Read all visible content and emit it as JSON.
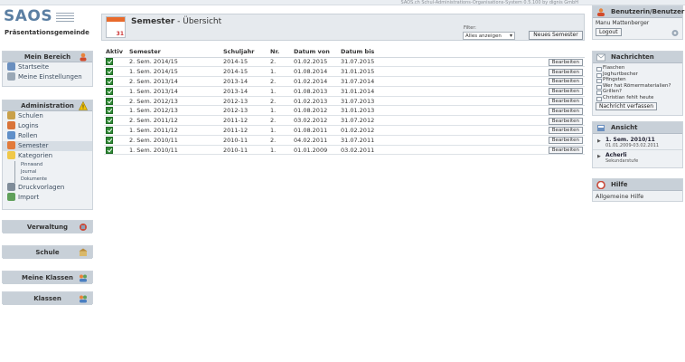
{
  "topbar": {
    "text": "SAOS.ch Schul-Administrations-Organisations-System 0.5.100 by dignis GmbH"
  },
  "logo": {
    "text": "SAOS",
    "subtitle": "Präsentationsgemeinde"
  },
  "sidebar": {
    "mein_bereich": {
      "title": "Mein Bereich",
      "items": [
        {
          "label": "Startseite"
        },
        {
          "label": "Meine Einstellungen"
        }
      ]
    },
    "administration": {
      "title": "Administration",
      "items": [
        {
          "label": "Schulen"
        },
        {
          "label": "Logins"
        },
        {
          "label": "Rollen"
        },
        {
          "label": "Semester"
        },
        {
          "label": "Kategorien"
        }
      ],
      "subitems": [
        {
          "label": "Pinnwand"
        },
        {
          "label": "Journal"
        },
        {
          "label": "Dokumente"
        }
      ],
      "more": [
        {
          "label": "Druckvorlagen"
        },
        {
          "label": "Import"
        }
      ]
    },
    "verwaltung": {
      "title": "Verwaltung"
    },
    "schule": {
      "title": "Schule"
    },
    "meine_klassen": {
      "title": "Meine Klassen"
    },
    "klassen": {
      "title": "Klassen"
    }
  },
  "main": {
    "title": "Semester",
    "subtitle": " - Übersicht",
    "calendar_number": "31",
    "filter_label": "Filter:",
    "filter_value": "Alles anzeigen",
    "new_button": "Neues Semester",
    "columns": [
      "Aktiv",
      "Semester",
      "Schuljahr",
      "Nr.",
      "Datum von",
      "Datum bis",
      ""
    ],
    "edit_label": "Bearbeiten",
    "rows": [
      {
        "semester": "2. Sem. 2014/15",
        "schuljahr": "2014-15",
        "nr": "2.",
        "von": "01.02.2015",
        "bis": "31.07.2015"
      },
      {
        "semester": "1. Sem. 2014/15",
        "schuljahr": "2014-15",
        "nr": "1.",
        "von": "01.08.2014",
        "bis": "31.01.2015"
      },
      {
        "semester": "2. Sem. 2013/14",
        "schuljahr": "2013-14",
        "nr": "2.",
        "von": "01.02.2014",
        "bis": "31.07.2014"
      },
      {
        "semester": "1. Sem. 2013/14",
        "schuljahr": "2013-14",
        "nr": "1.",
        "von": "01.08.2013",
        "bis": "31.01.2014"
      },
      {
        "semester": "2. Sem. 2012/13",
        "schuljahr": "2012-13",
        "nr": "2.",
        "von": "01.02.2013",
        "bis": "31.07.2013"
      },
      {
        "semester": "1. Sem. 2012/13",
        "schuljahr": "2012-13",
        "nr": "1.",
        "von": "01.08.2012",
        "bis": "31.01.2013"
      },
      {
        "semester": "2. Sem. 2011/12",
        "schuljahr": "2011-12",
        "nr": "2.",
        "von": "03.02.2012",
        "bis": "31.07.2012"
      },
      {
        "semester": "1. Sem. 2011/12",
        "schuljahr": "2011-12",
        "nr": "1.",
        "von": "01.08.2011",
        "bis": "01.02.2012"
      },
      {
        "semester": "2. Sem. 2010/11",
        "schuljahr": "2010-11",
        "nr": "2.",
        "von": "04.02.2011",
        "bis": "31.07.2011"
      },
      {
        "semester": "1. Sem. 2010/11",
        "schuljahr": "2010-11",
        "nr": "1.",
        "von": "01.01.2009",
        "bis": "03.02.2011"
      }
    ]
  },
  "right": {
    "user": {
      "title": "Benutzerin/Benutzer",
      "name": "Manu Mattenberger",
      "logout": "Logout"
    },
    "news": {
      "title": "Nachrichten",
      "items": [
        "Flaschen",
        "Joghurtbecher",
        "Pfingsten",
        "Wer hat Römermaterialien?",
        "Grillen?",
        "Christian fehlt heute"
      ],
      "button": "Nachricht verfassen"
    },
    "ansicht": {
      "title": "Ansicht",
      "items": [
        {
          "name": "1. Sem. 2010/11",
          "detail": "01.01.2009-03.02.2011"
        },
        {
          "name": "Acherli",
          "detail": "Sekundarstufe"
        }
      ]
    },
    "hilfe": {
      "title": "Hilfe",
      "link": "Allgemeine Hilfe"
    }
  },
  "colors": {
    "accent": "#5b7fa3",
    "check": "#2f8a35",
    "panel_head": "#c8d0d8"
  }
}
